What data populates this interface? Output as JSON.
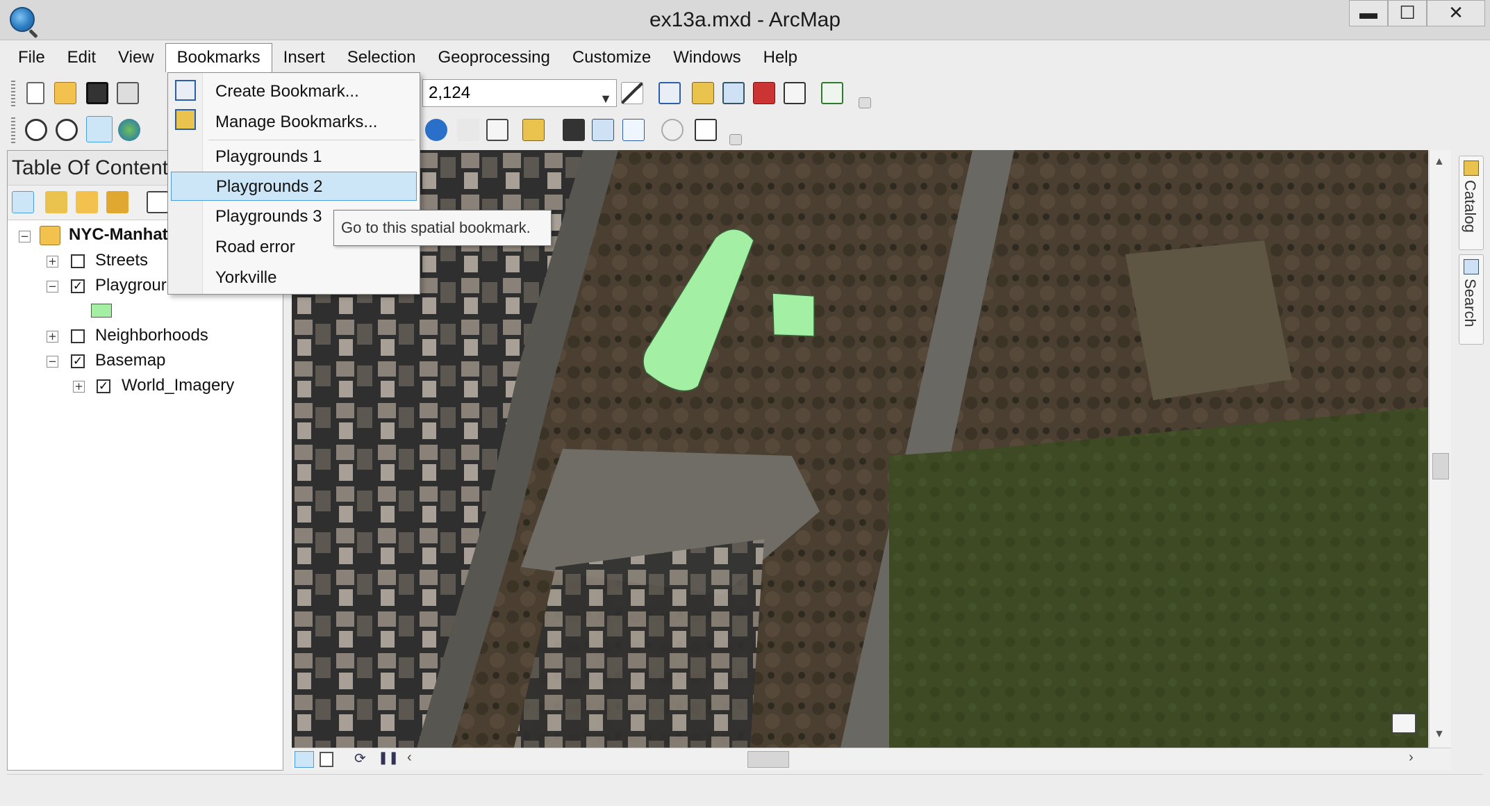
{
  "window": {
    "title": "ex13a.mxd - ArcMap",
    "min": "▬",
    "max": "☐",
    "close": "✕"
  },
  "menubar": [
    "File",
    "Edit",
    "View",
    "Bookmarks",
    "Insert",
    "Selection",
    "Geoprocessing",
    "Customize",
    "Windows",
    "Help"
  ],
  "toolbar": {
    "scale_value": "2,124"
  },
  "toc": {
    "title": "Table Of Contents",
    "frame": "NYC-Manhat",
    "layers": [
      {
        "label": "Streets",
        "checked": false
      },
      {
        "label": "Playgrour",
        "checked": true
      },
      {
        "label": "Neighborhoods",
        "checked": false
      },
      {
        "label": "Basemap",
        "checked": true
      },
      {
        "label": "World_Imagery",
        "checked": true
      }
    ]
  },
  "bookmarks_menu": {
    "create": "Create Bookmark...",
    "manage": "Manage Bookmarks...",
    "items": [
      "Playgrounds 1",
      "Playgrounds 2",
      "Playgrounds 3",
      "Road error",
      "Yorkville"
    ],
    "highlighted": "Playgrounds 2",
    "tooltip": "Go to this spatial bookmark."
  },
  "side_tabs": [
    "Catalog",
    "Search"
  ],
  "colors": {
    "playground_fill": "#a3efa3",
    "menu_highlight": "#cde6f7"
  }
}
